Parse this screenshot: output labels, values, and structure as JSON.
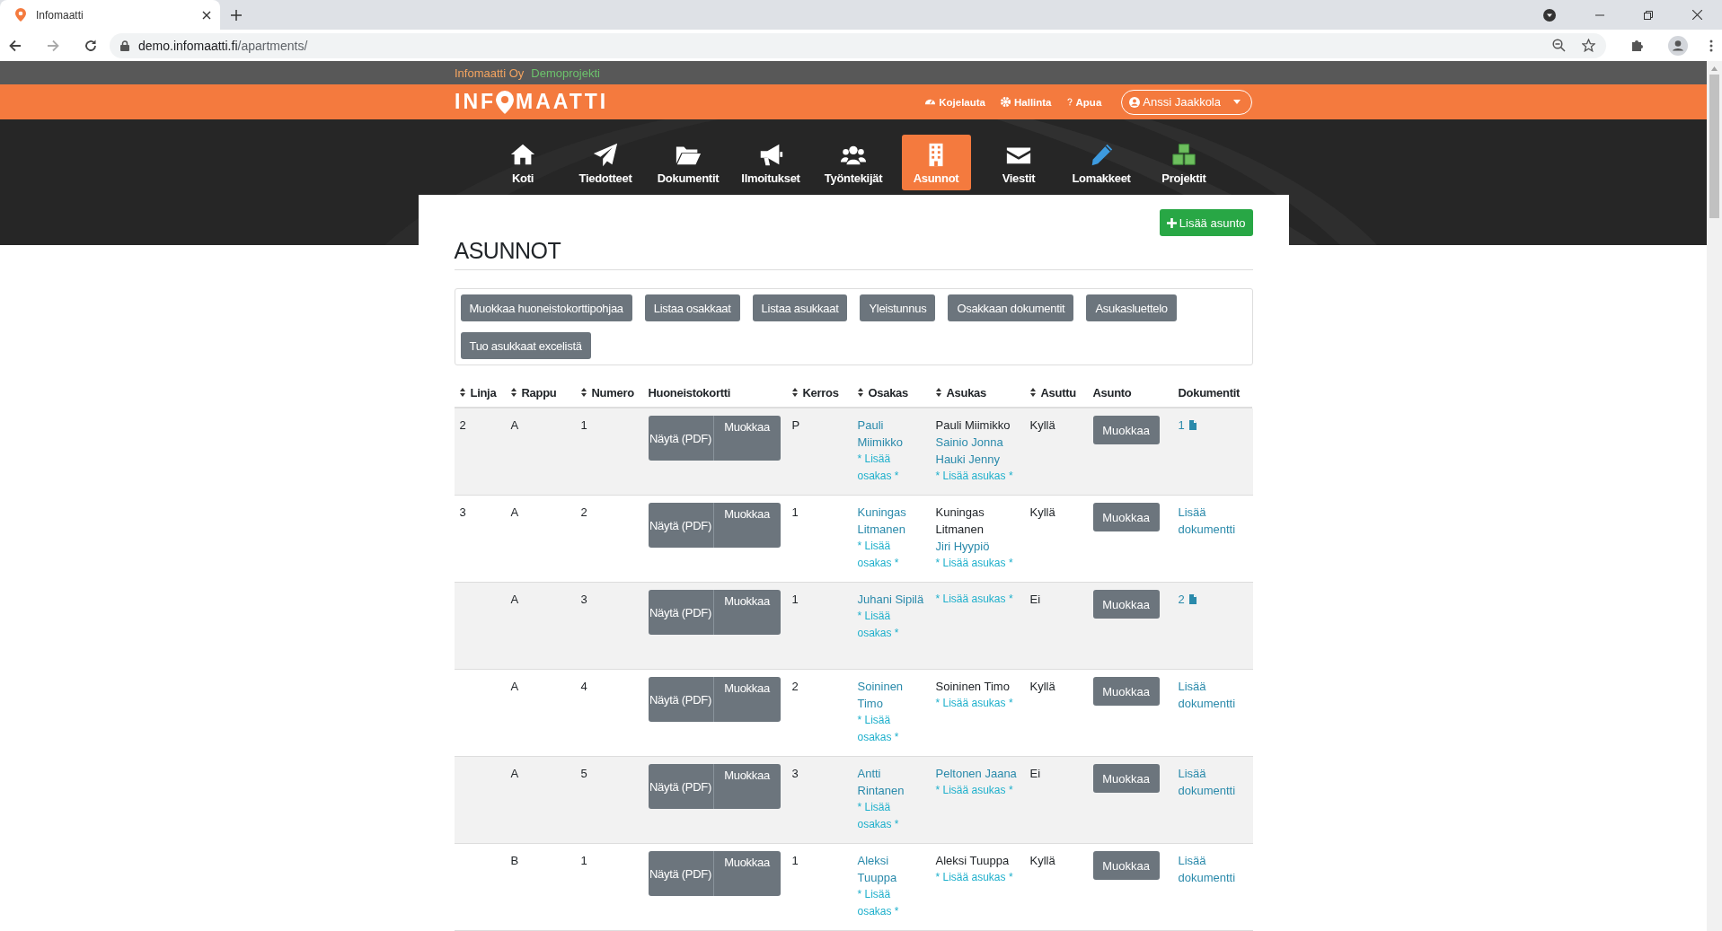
{
  "browser": {
    "tab_title": "Infomaatti",
    "url_host": "demo.infomaatti.fi",
    "url_path": "/apartments/"
  },
  "site": {
    "company": "Infomaatti Oy",
    "project": "Demoprojekti",
    "logo": {
      "before_pin": "INF",
      "after_pin": "MAATTI"
    },
    "top_links": [
      {
        "label": "Kojelauta"
      },
      {
        "label": "Hallinta"
      },
      {
        "label": "Apua"
      }
    ],
    "user_menu": {
      "label": "Anssi Jaakkola"
    }
  },
  "nav": [
    {
      "label": "Koti",
      "selected": false
    },
    {
      "label": "Tiedotteet",
      "selected": false
    },
    {
      "label": "Dokumentit",
      "selected": false
    },
    {
      "label": "Ilmoitukset",
      "selected": false
    },
    {
      "label": "Työntekijät",
      "selected": false
    },
    {
      "label": "Asunnot",
      "selected": true
    },
    {
      "label": "Viestit",
      "selected": false
    },
    {
      "label": "Lomakkeet",
      "selected": false
    },
    {
      "label": "Projektit",
      "selected": false
    }
  ],
  "page": {
    "title": "ASUNNOT",
    "add_button": "Lisää asunto",
    "actions": [
      "Muokkaa huoneistokorttipohjaa",
      "Listaa osakkaat",
      "Listaa asukkaat",
      "Yleistunnus",
      "Osakkaan dokumentit",
      "Asukasluettelo",
      "Tuo asukkaat excelistä"
    ]
  },
  "table": {
    "columns": [
      {
        "label": "Linja",
        "sortable": true
      },
      {
        "label": "Rappu",
        "sortable": true
      },
      {
        "label": "Numero",
        "sortable": true
      },
      {
        "label": "Huoneistokortti",
        "sortable": false
      },
      {
        "label": "Kerros",
        "sortable": true
      },
      {
        "label": "Osakas",
        "sortable": true
      },
      {
        "label": "Asukas",
        "sortable": true
      },
      {
        "label": "Asuttu",
        "sortable": true
      },
      {
        "label": "Asunto",
        "sortable": false
      },
      {
        "label": "Dokumentit",
        "sortable": false
      }
    ],
    "rows": [
      {
        "linja": "2",
        "rappu": "A",
        "numero": "1",
        "card_buttons": [
          "Näytä (PDF)",
          "Muokkaa"
        ],
        "kerros": "P",
        "owner": "Pauli Miimikko",
        "add_owner": "* Lisää osakas *",
        "residents": [
          {
            "name": "Pauli Miimikko",
            "linked": false
          },
          {
            "name": "Sainio Jonna",
            "linked": true
          },
          {
            "name": "Hauki Jenny",
            "linked": true
          }
        ],
        "add_resident": "* Lisää asukas *",
        "occupied": "Kyllä",
        "edit": "Muokkaa",
        "documents": {
          "kind": "count",
          "label": "1"
        }
      },
      {
        "linja": "3",
        "rappu": "A",
        "numero": "2",
        "card_buttons": [
          "Näytä (PDF)",
          "Muokkaa"
        ],
        "kerros": "1",
        "owner": "Kuningas Litmanen",
        "add_owner": "* Lisää osakas *",
        "residents": [
          {
            "name": "Kuningas Litmanen",
            "linked": false
          },
          {
            "name": "Jiri Hyypiö",
            "linked": true
          }
        ],
        "add_resident": "* Lisää asukas *",
        "occupied": "Kyllä",
        "edit": "Muokkaa",
        "documents": {
          "kind": "add",
          "label": "Lisää dokumentti"
        }
      },
      {
        "rappu": "A",
        "numero": "3",
        "card_buttons": [
          "Näytä (PDF)",
          "Muokkaa"
        ],
        "kerros": "1",
        "owner": "Juhani Sipilä",
        "add_owner": "* Lisää osakas *",
        "add_resident": "* Lisää asukas *",
        "occupied": "Ei",
        "edit": "Muokkaa",
        "documents": {
          "kind": "count",
          "label": "2"
        }
      },
      {
        "rappu": "A",
        "numero": "4",
        "card_buttons": [
          "Näytä (PDF)",
          "Muokkaa"
        ],
        "kerros": "2",
        "owner": "Soininen Timo",
        "add_owner": "* Lisää osakas *",
        "residents": [
          {
            "name": "Soininen Timo",
            "linked": false
          }
        ],
        "add_resident": "* Lisää asukas *",
        "occupied": "Kyllä",
        "edit": "Muokkaa",
        "documents": {
          "kind": "add",
          "label": "Lisää dokumentti"
        }
      },
      {
        "rappu": "A",
        "numero": "5",
        "card_buttons": [
          "Näytä (PDF)",
          "Muokkaa"
        ],
        "kerros": "3",
        "owner": "Antti Rintanen",
        "add_owner": "* Lisää osakas *",
        "residents": [
          {
            "name": "Peltonen Jaana",
            "linked": true
          }
        ],
        "add_resident": "* Lisää asukas *",
        "occupied": "Ei",
        "edit": "Muokkaa",
        "documents": {
          "kind": "add",
          "label": "Lisää dokumentti"
        }
      },
      {
        "rappu": "B",
        "numero": "1",
        "card_buttons": [
          "Näytä (PDF)",
          "Muokkaa"
        ],
        "kerros": "1",
        "owner": "Aleksi Tuuppa",
        "add_owner": "* Lisää osakas *",
        "residents": [
          {
            "name": "Aleksi Tuuppa",
            "linked": false
          }
        ],
        "add_resident": "* Lisää asukas *",
        "occupied": "Kyllä",
        "edit": "Muokkaa",
        "documents": {
          "kind": "add",
          "label": "Lisää dokumentti"
        }
      }
    ]
  }
}
